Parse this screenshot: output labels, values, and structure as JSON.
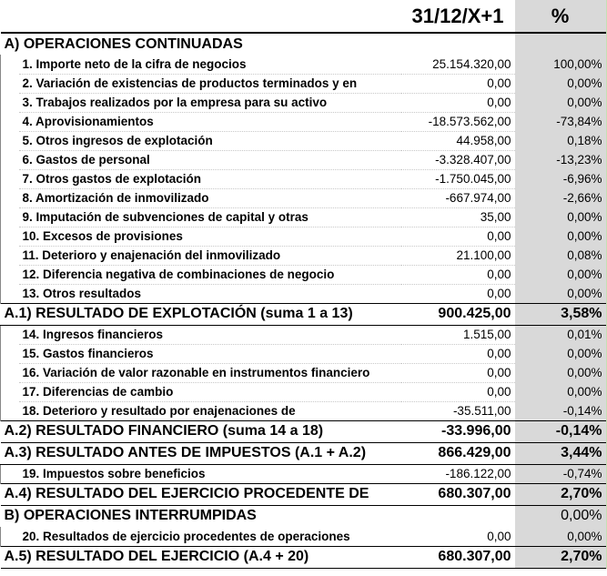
{
  "header": {
    "period": "31/12/X+1",
    "percent": "%"
  },
  "rows": [
    {
      "kind": "section",
      "label": "A) OPERACIONES CONTINUADAS",
      "value": "",
      "pct": ""
    },
    {
      "kind": "item",
      "label": "1. Importe neto de la cifra de negocios",
      "value": "25.154.320,00",
      "pct": "100,00%"
    },
    {
      "kind": "item",
      "label": "2. Variación de existencias de productos terminados y en",
      "value": "0,00",
      "pct": "0,00%"
    },
    {
      "kind": "item",
      "label": "3. Trabajos realizados por la empresa para su activo",
      "value": "0,00",
      "pct": "0,00%"
    },
    {
      "kind": "item",
      "label": "4. Aprovisionamientos",
      "value": "-18.573.562,00",
      "pct": "-73,84%"
    },
    {
      "kind": "item",
      "label": "5. Otros ingresos de explotación",
      "value": "44.958,00",
      "pct": "0,18%"
    },
    {
      "kind": "item",
      "label": "6. Gastos de personal",
      "value": "-3.328.407,00",
      "pct": "-13,23%"
    },
    {
      "kind": "item",
      "label": "7. Otros gastos de explotación",
      "value": "-1.750.045,00",
      "pct": "-6,96%"
    },
    {
      "kind": "item",
      "label": "8. Amortización de inmovilizado",
      "value": "-667.974,00",
      "pct": "-2,66%"
    },
    {
      "kind": "item",
      "label": "9. Imputación de subvenciones de capital y otras",
      "value": "35,00",
      "pct": "0,00%"
    },
    {
      "kind": "item",
      "label": "10. Excesos de provisiones",
      "value": "0,00",
      "pct": "0,00%"
    },
    {
      "kind": "item",
      "label": "11. Deterioro y enajenación del inmovilizado",
      "value": "21.100,00",
      "pct": "0,08%"
    },
    {
      "kind": "item",
      "label": "12. Diferencia negativa de combinaciones de negocio",
      "value": "0,00",
      "pct": "0,00%"
    },
    {
      "kind": "item",
      "label": "13. Otros resultados",
      "value": "0,00",
      "pct": "0,00%"
    },
    {
      "kind": "result",
      "label": "A.1) RESULTADO DE EXPLOTACIÓN (suma 1 a 13)",
      "value": "900.425,00",
      "pct": "3,58%"
    },
    {
      "kind": "item",
      "label": "14. Ingresos financieros",
      "value": "1.515,00",
      "pct": "0,01%"
    },
    {
      "kind": "item",
      "label": "15. Gastos financieros",
      "value": "0,00",
      "pct": "0,00%"
    },
    {
      "kind": "item",
      "label": "16. Variación de valor razonable en instrumentos financiero",
      "value": "0,00",
      "pct": "0,00%"
    },
    {
      "kind": "item",
      "label": "17. Diferencias de cambio",
      "value": "0,00",
      "pct": "0,00%"
    },
    {
      "kind": "item",
      "label": "18. Deterioro y resultado por enajenaciones de",
      "value": "-35.511,00",
      "pct": "-0,14%"
    },
    {
      "kind": "result",
      "label": "A.2) RESULTADO FINANCIERO (suma 14 a 18)",
      "value": "-33.996,00",
      "pct": "-0,14%"
    },
    {
      "kind": "result",
      "label": "A.3) RESULTADO ANTES DE IMPUESTOS (A.1 + A.2)",
      "value": "866.429,00",
      "pct": "3,44%"
    },
    {
      "kind": "item",
      "label": "19. Impuestos sobre beneficios",
      "value": "-186.122,00",
      "pct": "-0,74%"
    },
    {
      "kind": "result",
      "label": "A.4) RESULTADO DEL EJERCICIO PROCEDENTE DE",
      "value": "680.307,00",
      "pct": "2,70%"
    },
    {
      "kind": "section",
      "label": "B) OPERACIONES INTERRUMPIDAS",
      "value": "",
      "pct": "0,00%"
    },
    {
      "kind": "item",
      "label": "20. Resultados de ejercicio procedentes de operaciones",
      "value": "0,00",
      "pct": "0,00%"
    },
    {
      "kind": "result",
      "label": "A.5) RESULTADO DEL EJERCICIO (A.4 + 20)",
      "value": "680.307,00",
      "pct": "2,70%"
    }
  ]
}
